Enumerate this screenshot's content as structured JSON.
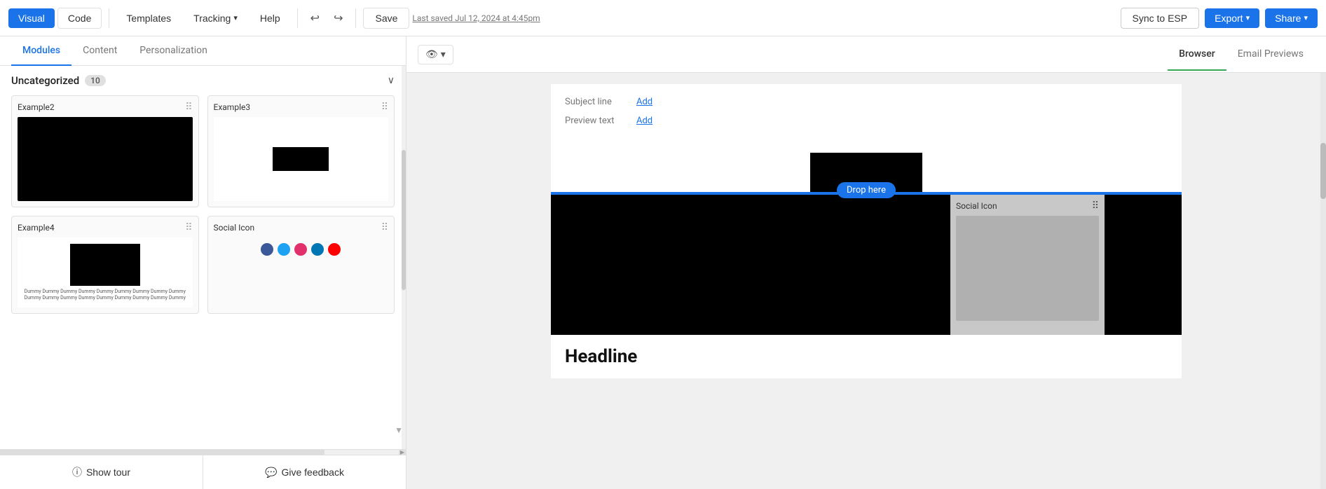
{
  "toolbar": {
    "visual_label": "Visual",
    "code_label": "Code",
    "templates_label": "Templates",
    "tracking_label": "Tracking",
    "help_label": "Help",
    "save_label": "Save",
    "last_saved": "Last saved Jul 12, 2024 at 4:45pm",
    "sync_esp_label": "Sync to ESP",
    "export_label": "Export",
    "share_label": "Share"
  },
  "left_panel": {
    "tabs": [
      {
        "label": "Modules",
        "active": true
      },
      {
        "label": "Content",
        "active": false
      },
      {
        "label": "Personalization",
        "active": false
      }
    ],
    "category": {
      "name": "Uncategorized",
      "count": "10"
    },
    "modules": [
      {
        "name": "Example2",
        "type": "full-black"
      },
      {
        "name": "Example3",
        "type": "center-black"
      },
      {
        "name": "Example4",
        "type": "image-text"
      },
      {
        "name": "Social Icon",
        "type": "social"
      }
    ],
    "show_tour_label": "Show tour",
    "give_feedback_label": "Give feedback"
  },
  "right_panel": {
    "view_toggle": "👁",
    "tabs": [
      {
        "label": "Browser",
        "active": true
      },
      {
        "label": "Email Previews",
        "active": false
      }
    ],
    "subject_line_label": "Subject line",
    "subject_line_add": "Add",
    "preview_text_label": "Preview text",
    "preview_text_add": "Add",
    "drop_here": "Drop here",
    "social_module_name": "Social Icon",
    "headline": "Headline"
  },
  "icons": {
    "drag": "⠿",
    "chevron_down": "∨",
    "tour": "ⓘ",
    "feedback": "💬",
    "eye": "👁",
    "caret_down": "▾"
  }
}
